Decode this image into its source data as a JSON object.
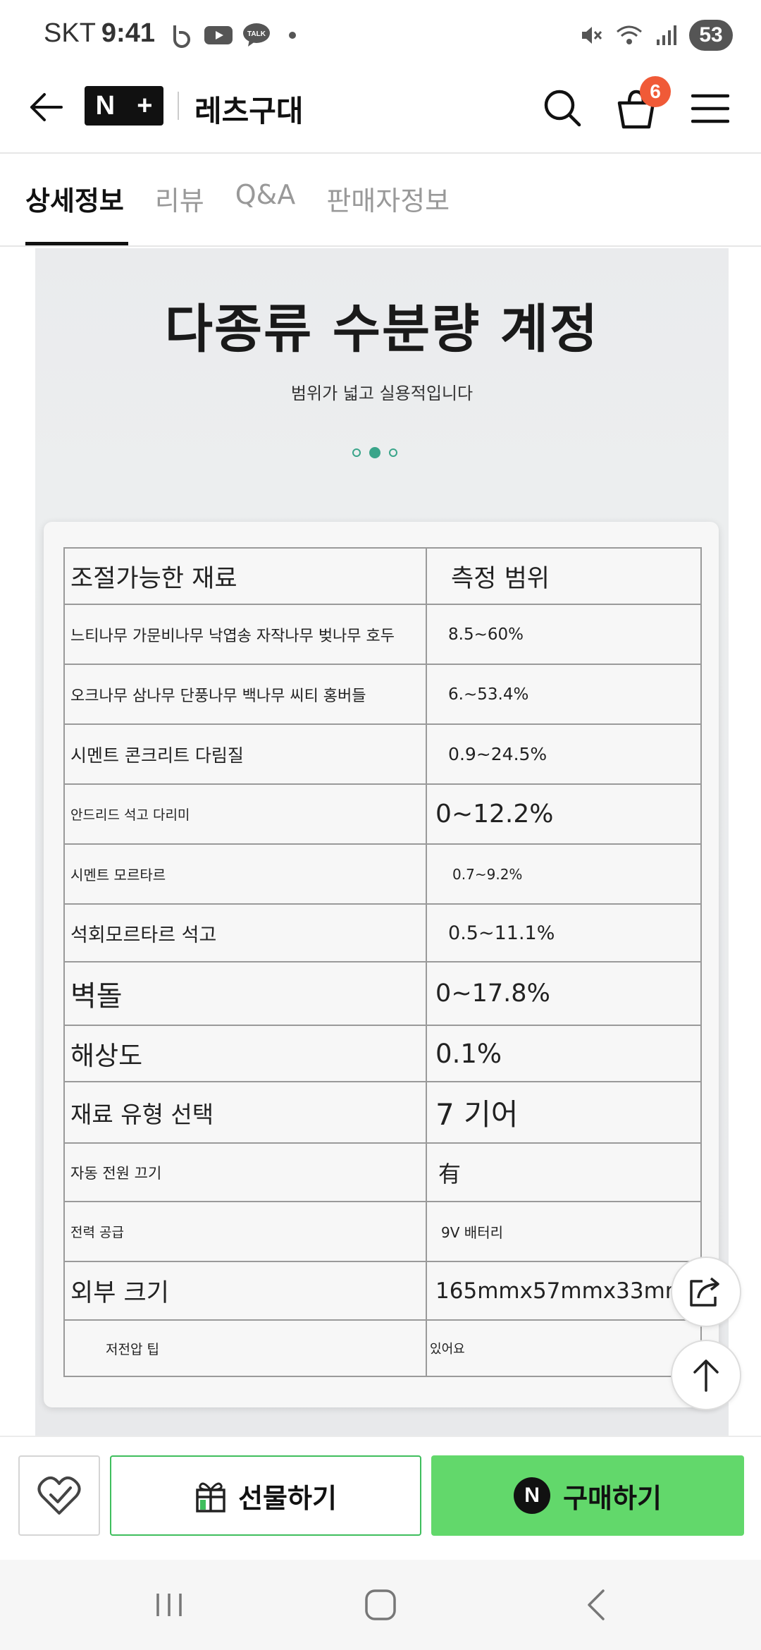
{
  "status_bar": {
    "carrier": "SKT",
    "time": "9:41",
    "battery": "53"
  },
  "header": {
    "logo_text_n": "N",
    "logo_text_plus": "+",
    "store_name": "레츠구대",
    "cart_count": "6",
    "icons": [
      "back-arrow-icon",
      "search-icon",
      "cart-icon",
      "menu-icon"
    ]
  },
  "tabs": [
    {
      "label": "상세정보",
      "active": true
    },
    {
      "label": "리뷰",
      "active": false
    },
    {
      "label": "Q&A",
      "active": false
    },
    {
      "label": "판매자정보",
      "active": false
    }
  ],
  "promo": {
    "title": "다종류 수분량 계정",
    "subtitle": "범위가 넓고 실용적입니다",
    "carousel_active_index": 1,
    "carousel_count": 3
  },
  "spec_table": {
    "rows": [
      {
        "material": "조절가능한 재료",
        "range": "측정 범위"
      },
      {
        "material": "느티나무 가문비나무 낙엽송 자작나무 벚나무 호두",
        "range": "8.5~60%"
      },
      {
        "material": "오크나무 삼나무 단풍나무 백나무 씨티 홍버들",
        "range": "6.~53.4%"
      },
      {
        "material": "시멘트 콘크리트 다림질",
        "range": "0.9~24.5%"
      },
      {
        "material": "안드리드 석고 다리미",
        "range": "0~12.2%"
      },
      {
        "material": "시멘트 모르타르",
        "range": "0.7~9.2%"
      },
      {
        "material": "석회모르타르 석고",
        "range": "0.5~11.1%"
      },
      {
        "material": "벽돌",
        "range": "0~17.8%"
      },
      {
        "material": "해상도",
        "range": "0.1%"
      },
      {
        "material": "재료 유형 선택",
        "range": "7 기어"
      },
      {
        "material": "자동 전원 끄기",
        "range": "有"
      },
      {
        "material": "전력 공급",
        "range": "9V 배터리"
      },
      {
        "material": "외부 크기",
        "range": "165mmx57mmx33mm"
      },
      {
        "material": "저전압 팁",
        "range": "있어요"
      }
    ]
  },
  "floating": {
    "share_icon": "share-icon",
    "top_icon": "arrow-up-icon"
  },
  "buy_bar": {
    "gift_label": "선물하기",
    "buy_label": "구매하기",
    "npay_letter": "N",
    "accent_color": "#62d86b",
    "gift_border_color": "#3fbe5d"
  },
  "colors": {
    "badge": "#f05a37",
    "carousel": "#3aa58a"
  }
}
